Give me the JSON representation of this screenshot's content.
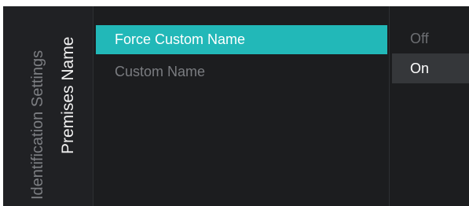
{
  "breadcrumb": {
    "parent": "Identification Settings",
    "current": "Premises Name"
  },
  "menu": {
    "items": [
      {
        "label": "Force Custom Name"
      },
      {
        "label": "Custom Name"
      }
    ]
  },
  "options": {
    "items": [
      {
        "label": "Off"
      },
      {
        "label": "On"
      }
    ]
  },
  "colors": {
    "accent": "#22b8b8",
    "background": "#1c1d1f",
    "option_highlight": "#35373a"
  }
}
